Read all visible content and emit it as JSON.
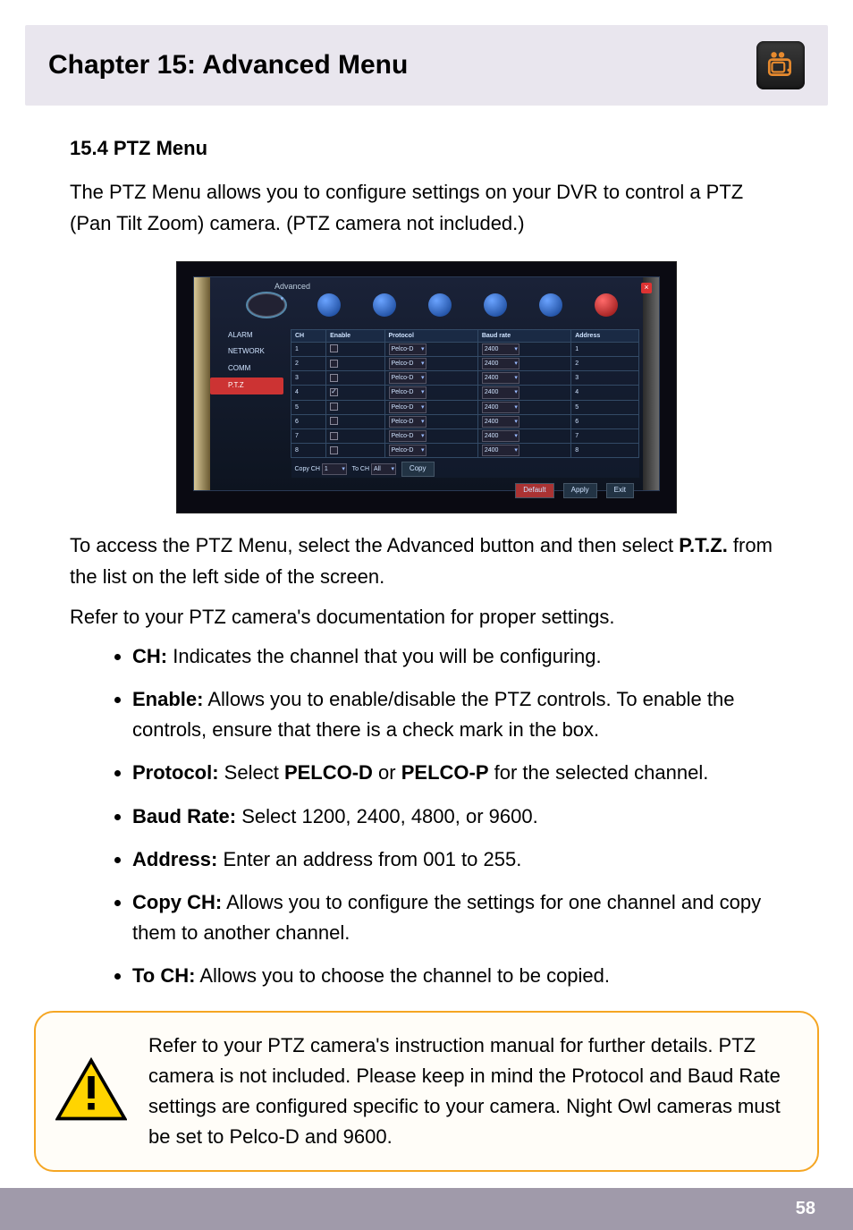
{
  "header": {
    "chapter_title": "Chapter 15: Advanced Menu"
  },
  "section": {
    "heading": "15.4 PTZ Menu",
    "intro": "The PTZ Menu allows you to configure settings on your DVR to control a PTZ (Pan Tilt Zoom) camera. (PTZ camera not included.)",
    "access_line_pre": "To access the PTZ Menu, select the Advanced button and then select ",
    "access_line_bold": "P.T.Z.",
    "access_line_post": " from the list on the left side of the screen.",
    "refer_line": "Refer to your PTZ camera's documentation for proper settings."
  },
  "items": [
    {
      "key": "CH:",
      "text": " Indicates the channel that you will be configuring."
    },
    {
      "key": "Enable:",
      "text": " Allows you to enable/disable the PTZ controls. To enable the controls, ensure that there is a check mark in the box."
    },
    {
      "key": "Protocol:",
      "text_pre": " Select ",
      "bold1": "PELCO-D",
      "mid": " or ",
      "bold2": "PELCO-P",
      "text_post": " for the selected channel."
    },
    {
      "key": "Baud Rate:",
      "text": " Select 1200, 2400, 4800, or 9600."
    },
    {
      "key": "Address:",
      "text": " Enter an address from 001 to 255."
    },
    {
      "key": "Copy CH:",
      "text": " Allows you to configure the settings for one channel and copy them to another channel."
    },
    {
      "key": "To CH:",
      "text": " Allows you to choose the channel to be copied."
    }
  ],
  "callout": {
    "text": "Refer to your PTZ camera's instruction manual for further details. PTZ camera is not included. Please keep in mind the Protocol and Baud Rate settings are configured specific to your camera. Night Owl cameras must be set to Pelco-D and 9600."
  },
  "footer": {
    "page_number": "58"
  },
  "screenshot": {
    "breadcrumb": "Advanced",
    "side_items": [
      "ALARM",
      "NETWORK",
      "COMM",
      "P.T.Z"
    ],
    "active_side_index": 3,
    "columns": [
      "CH",
      "Enable",
      "Protocol",
      "Baud rate",
      "Address"
    ],
    "rows": [
      {
        "ch": "1",
        "enable": false,
        "protocol": "Pelco-D",
        "baud": "2400",
        "addr": "1"
      },
      {
        "ch": "2",
        "enable": false,
        "protocol": "Pelco-D",
        "baud": "2400",
        "addr": "2"
      },
      {
        "ch": "3",
        "enable": false,
        "protocol": "Pelco-D",
        "baud": "2400",
        "addr": "3"
      },
      {
        "ch": "4",
        "enable": true,
        "protocol": "Pelco-D",
        "baud": "2400",
        "addr": "4"
      },
      {
        "ch": "5",
        "enable": false,
        "protocol": "Pelco-D",
        "baud": "2400",
        "addr": "5"
      },
      {
        "ch": "6",
        "enable": false,
        "protocol": "Pelco-D",
        "baud": "2400",
        "addr": "6"
      },
      {
        "ch": "7",
        "enable": false,
        "protocol": "Pelco-D",
        "baud": "2400",
        "addr": "7"
      },
      {
        "ch": "8",
        "enable": false,
        "protocol": "Pelco-D",
        "baud": "2400",
        "addr": "8"
      }
    ],
    "copy": {
      "copy_label": "Copy CH",
      "copy_value": "1",
      "to_label": "To CH",
      "to_value": "All",
      "copy_btn": "Copy"
    },
    "buttons": {
      "default": "Default",
      "apply": "Apply",
      "exit": "Exit"
    }
  }
}
